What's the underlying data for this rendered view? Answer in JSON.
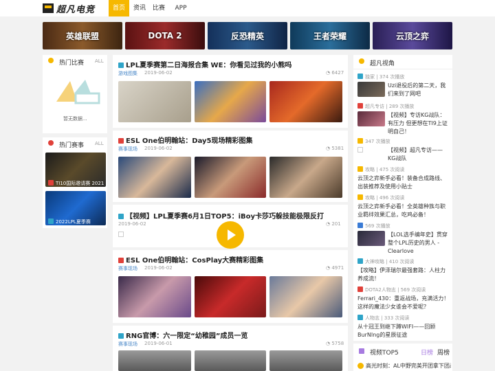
{
  "header": {
    "logo_text": "超凡电竞",
    "nav": [
      "首页",
      "资讯",
      "比赛",
      "APP"
    ]
  },
  "banners": [
    {
      "label": "英雄联盟",
      "color": "#6b3b1a"
    },
    {
      "label": "DOTA 2",
      "color": "#7a1d1d"
    },
    {
      "label": "反恐精英",
      "color": "#1f3d6b"
    },
    {
      "label": "王者荣耀",
      "color": "#1a4b6e"
    },
    {
      "label": "云顶之弈",
      "color": "#3a2e6b"
    }
  ],
  "left": {
    "hot_matches": {
      "title": "热门比赛",
      "all": "ALL",
      "empty": "暂无数据..."
    },
    "hot_events": {
      "title": "热门赛事",
      "all": "ALL",
      "items": [
        "TI10国际邀请赛 2021",
        "2022LPL夏季赛"
      ]
    }
  },
  "feed": [
    {
      "title": "LPL夏季赛第二日海报合集 WE：你看见过我的小熊吗",
      "tag": "游戏图集",
      "date": "2019-06-02",
      "views": "6427",
      "type": "cyan"
    },
    {
      "title": "ESL One伯明翰站：Day5现场精彩图集",
      "tag": "赛事现场",
      "date": "2019-06-02",
      "views": "5381",
      "type": "red"
    },
    {
      "title": "【视频】LPL夏季赛6月1日TOP5：iBoy卡莎巧躲技能极限反打",
      "tag": "",
      "date": "2019-06-02",
      "views": "201",
      "type": "cyan"
    },
    {
      "title": "ESL One伯明翰站：CosPlay大赛精彩图集",
      "tag": "赛事现场",
      "date": "2019-06-02",
      "views": "4971",
      "type": "red"
    },
    {
      "title": "RNG官博：六一限定“幼稚园”成员一览",
      "tag": "赛事现场",
      "date": "2019-06-01",
      "views": "5758",
      "type": "cyan"
    }
  ],
  "right": {
    "title": "超凡视角",
    "items": [
      {
        "meta": "独家",
        "views": "374 次播放",
        "text": "Uzi退役后的第二天，我们来到了网吧",
        "type": "cyan"
      },
      {
        "meta": "超凡专访",
        "views": "289 次播放",
        "text": "【视频】专访KG战队：有压力 但更想在TI9上证明自己！",
        "type": "red"
      },
      {
        "meta": "",
        "views": "347 次播放",
        "text": "【视频】超凡专访——KG战队",
        "type": "yel"
      },
      {
        "meta": "攻略",
        "views": "475 次阅读",
        "text": "云顶之弈新手必看！装备合成路线、出装推荐及使用小贴士",
        "type": "yel"
      },
      {
        "meta": "攻略",
        "views": "496 次阅读",
        "text": "云顶之弈新手必看！全英雄种族与职业羁绊效果汇总，吃鸡必备！",
        "type": "yel"
      },
      {
        "meta": "",
        "views": "569 次播放",
        "text": "【LOL选手编年史】贯穿整个LPL历史的男人 - Clearlove",
        "type": "blue"
      },
      {
        "meta": "大神攻略",
        "views": "410 次阅读",
        "text": "【攻略】伊泽瑞尔最强套路：人柱力养成流！",
        "type": "cyan"
      },
      {
        "meta": "DOTA2人物志",
        "views": "569 次阅读",
        "text": "Ferrari_430：重返战场，充满活力！这样的魔法少女谁会不爱呢？",
        "type": "red"
      },
      {
        "meta": "人物志",
        "views": "333 次阅读",
        "text": "从十冠王到继下蹲WIFI——回顾BurNIng的星辰征途",
        "type": "cyan"
      }
    ],
    "top5": {
      "title": "视频TOP5",
      "tabs": [
        "日榜",
        "周榜"
      ],
      "first": "高光时刻：AL中野完美开团拿下团战"
    }
  }
}
